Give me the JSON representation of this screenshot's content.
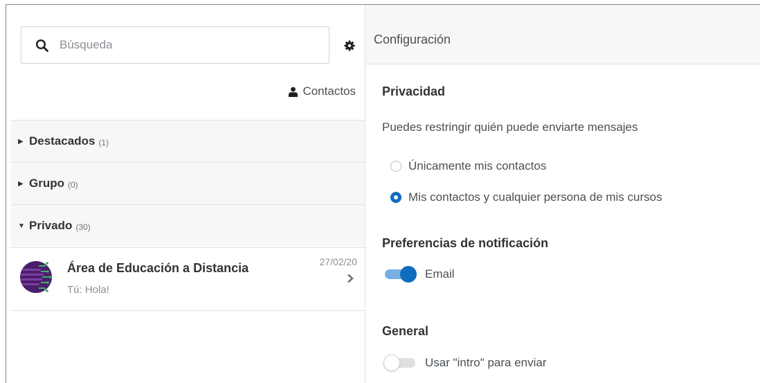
{
  "left": {
    "search": {
      "placeholder": "Búsqueda",
      "value": ""
    },
    "contacts_label": "Contactos",
    "sections": [
      {
        "title": "Destacados",
        "count": "(1)",
        "expanded": false
      },
      {
        "title": "Grupo",
        "count": "(0)",
        "expanded": false
      },
      {
        "title": "Privado",
        "count": "(30)",
        "expanded": true
      }
    ],
    "conversation": {
      "name": "Área de Educación a Distancia",
      "preview": "Tú: Hola!",
      "date": "27/02/20"
    }
  },
  "settings": {
    "title": "Configuración",
    "privacy": {
      "heading": "Privacidad",
      "description": "Puedes restringir quién puede enviarte mensajes",
      "options": [
        {
          "label": "Únicamente mis contactos",
          "selected": false
        },
        {
          "label": "Mis contactos y cualquier persona de mis cursos",
          "selected": true
        }
      ]
    },
    "notifications": {
      "heading": "Preferencias de notificación",
      "email_label": "Email",
      "email_enabled": true
    },
    "general": {
      "heading": "General",
      "enter_label": "Usar \"intro\" para enviar",
      "enter_enabled": false
    }
  },
  "colors": {
    "accent": "#0f6cbf",
    "accent_light": "#79aee2",
    "section_bg": "#f7f7f7",
    "border": "#dee2e6"
  }
}
